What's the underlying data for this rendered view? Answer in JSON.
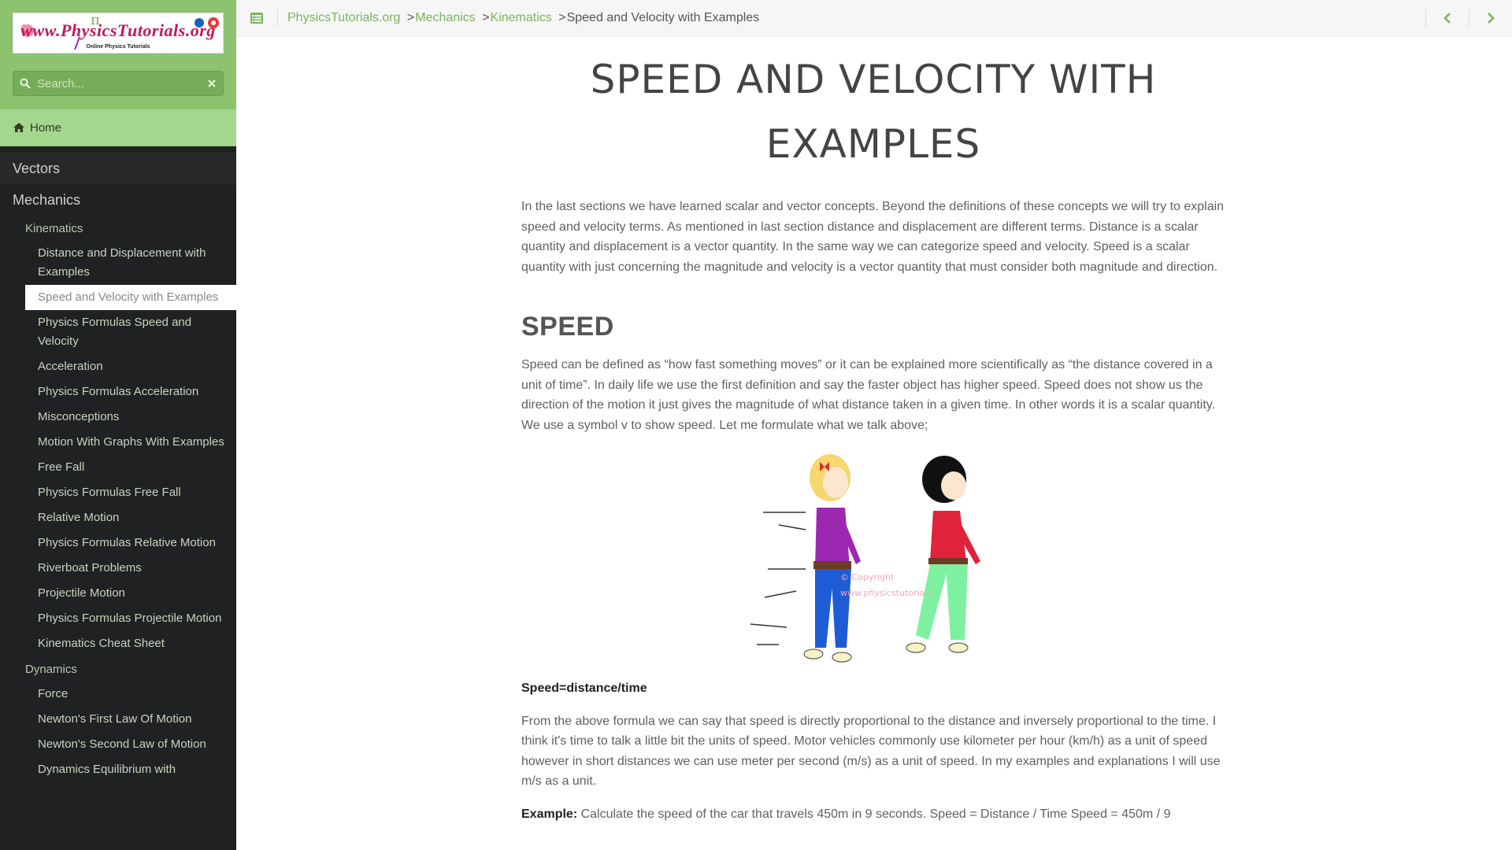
{
  "sidebar": {
    "logo_text": "www.PhysicsTutorials.org",
    "logo_subtext": "Online Physics Tutorials",
    "search_placeholder": "Search...",
    "home_label": "Home",
    "sections": [
      {
        "label": "Vectors"
      },
      {
        "label": "Mechanics"
      }
    ],
    "kinematics_label": "Kinematics",
    "kinematics_items": [
      "Distance and Displacement with Examples",
      "Speed and Velocity with Examples",
      "Physics Formulas Speed and Velocity",
      "Acceleration",
      "Physics Formulas Acceleration",
      "Misconceptions",
      "Motion With Graphs With Examples",
      "Free Fall",
      "Physics Formulas Free Fall",
      "Relative Motion",
      "Physics Formulas Relative Motion",
      "Riverboat Problems",
      "Projectile Motion",
      "Physics Formulas Projectile Motion",
      "Kinematics Cheat Sheet"
    ],
    "active_index": 1,
    "dynamics_label": "Dynamics",
    "dynamics_items": [
      "Force",
      "Newton's First Law Of Motion",
      "Newton's Second Law of Motion",
      "Dynamics Equilibrium with"
    ]
  },
  "topbar": {
    "crumbs": [
      "PhysicsTutorials.org",
      "Mechanics",
      "Kinematics"
    ],
    "current": "Speed and Velocity with Examples"
  },
  "content": {
    "title": "SPEED AND VELOCITY WITH EXAMPLES",
    "intro": "In the last sections we have learned scalar and vector concepts. Beyond the definitions of these concepts we will try to explain speed and velocity terms. As mentioned in last section distance and displacement are different terms. Distance is a scalar quantity and displacement is a vector quantity. In the same way we can categorize speed and velocity. Speed is a scalar quantity with just concerning the magnitude and velocity is a vector quantity that must consider both magnitude and direction.",
    "speed_heading": "SPEED",
    "speed_para": "Speed can be defined as “how fast something moves” or it can be explained more scientifically as “the distance covered in a unit of time”. In daily life we use the first definition and say the faster object has higher speed. Speed does not show us the direction of the motion it just gives the magnitude of what distance taken in a given time. In other words it is a scalar quantity. We use a symbol v to show speed. Let me formulate what we talk above;",
    "watermark_line1": "© Copyright",
    "watermark_line2": "www.physicstutorials",
    "formula": "Speed=distance/time",
    "units_para": "From the above formula we can say that speed is directly proportional to the distance and inversely proportional to the time. I think it's time to talk a little bit the units of speed. Motor vehicles commonly use kilometer per hour (km/h) as a unit of speed however in short distances we can use meter per second (m/s) as a unit of speed. In my examples and explanations I will use m/s as a unit.",
    "example_label": "Example:",
    "example_text": " Calculate the speed of the car that travels 450m in 9 seconds. Speed = Distance / Time Speed = 450m / 9"
  },
  "colors": {
    "accent_green": "#7cb35d",
    "sidebar_bg": "#1f2122",
    "brand_green": "#8dc26f"
  },
  "icons": [
    "search-icon",
    "clear-icon",
    "home-icon",
    "toc-icon",
    "chevron-left-icon",
    "chevron-right-icon"
  ]
}
